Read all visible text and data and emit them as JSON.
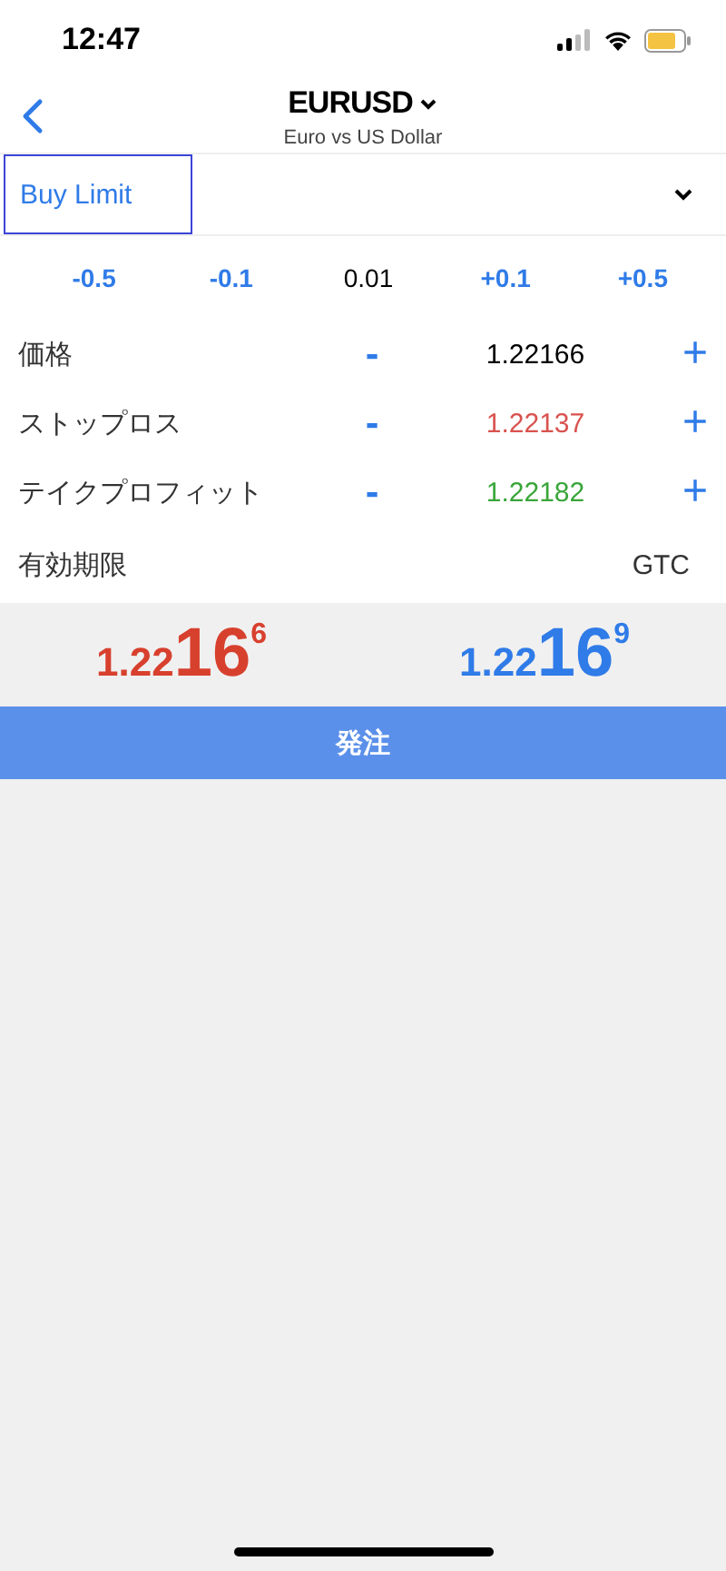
{
  "status_bar": {
    "time": "12:47"
  },
  "header": {
    "symbol": "EURUSD",
    "description": "Euro vs US Dollar"
  },
  "order_type": {
    "value": "Buy Limit",
    "focused": true
  },
  "steps": [
    {
      "label": "-0.5",
      "kind": "button"
    },
    {
      "label": "-0.1",
      "kind": "button"
    },
    {
      "label": "0.01",
      "kind": "value"
    },
    {
      "label": "+0.1",
      "kind": "button"
    },
    {
      "label": "+0.5",
      "kind": "button"
    }
  ],
  "fields": [
    {
      "label": "価格",
      "minus": "-",
      "value": "1.22166",
      "plus": "+",
      "color": "#000000"
    },
    {
      "label": "ストップロス",
      "minus": "-",
      "value": "1.22137",
      "plus": "+",
      "color": "#d9534f"
    },
    {
      "label": "テイクプロフィット",
      "minus": "-",
      "value": "1.22182",
      "plus": "+",
      "color": "#3aa63a"
    }
  ],
  "expiry": {
    "label": "有効期限",
    "value": "GTC"
  },
  "quotes": [
    {
      "small": "1.22",
      "big": "16",
      "sup": "6",
      "color": "#d8402e"
    },
    {
      "small": "1.22",
      "big": "16",
      "sup": "9",
      "color": "#2f7be8"
    }
  ],
  "submit": {
    "label": "発注"
  }
}
